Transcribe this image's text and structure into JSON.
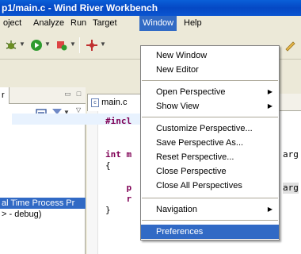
{
  "window": {
    "title": "p1/main.c - Wind River Workbench"
  },
  "menubar": {
    "items": [
      "oject",
      "Analyze",
      "Run",
      "Target",
      "Window",
      "Help"
    ],
    "open_item": "Window"
  },
  "toolbar": {
    "icons": [
      "debug-icon",
      "run-icon",
      "external-tools-icon",
      "target-icon",
      "pencil-icon"
    ]
  },
  "window_menu": {
    "items": [
      {
        "label": "New Window",
        "submenu": false
      },
      {
        "label": "New Editor",
        "submenu": false
      },
      {
        "label": "Open Perspective",
        "submenu": true
      },
      {
        "label": "Show View",
        "submenu": true
      },
      {
        "label": "Customize Perspective...",
        "submenu": false
      },
      {
        "label": "Save Perspective As...",
        "submenu": false
      },
      {
        "label": "Reset Perspective...",
        "submenu": false
      },
      {
        "label": "Close Perspective",
        "submenu": false
      },
      {
        "label": "Close All Perspectives",
        "submenu": false
      },
      {
        "label": "Navigation",
        "submenu": true
      },
      {
        "label": "Preferences",
        "submenu": false,
        "highlighted": true
      }
    ]
  },
  "left_panel": {
    "tab_label": "r",
    "rows": [
      {
        "text": "al Time Process Pr",
        "selected": true
      },
      {
        "text": "> - debug)",
        "selected": false
      }
    ]
  },
  "editor": {
    "tab_label": "main.c",
    "lines": [
      "#incl",
      "",
      "int m",
      "{",
      "    p",
      "    r",
      "}"
    ],
    "right_fragments": [
      "arg",
      "arg"
    ]
  },
  "colors": {
    "titlebar": "#0548c4",
    "selection": "#316ac5",
    "chrome": "#ece9d8"
  }
}
